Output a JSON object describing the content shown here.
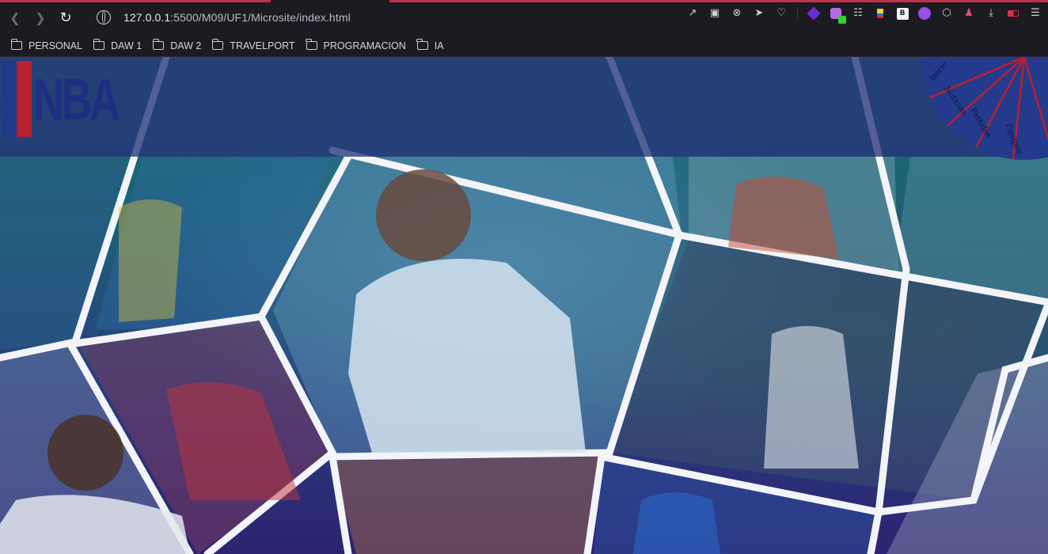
{
  "browser": {
    "url_host": "127.0.0.1",
    "url_path": ":5500/M09/UF1/Microsite/index.html",
    "bookmarks": [
      "PERSONAL",
      "DAW 1",
      "DAW 2",
      "TRAVELPORT",
      "PROGRAMACION",
      "IA"
    ],
    "extension_badge": "B"
  },
  "site": {
    "logo_text": "NBA",
    "menu": [
      "Inicio",
      "Noticias",
      "Partidos",
      "Equipos"
    ]
  },
  "colors": {
    "header_band": "#26347a",
    "accent_red": "#b8202e",
    "wheel": "#243a8c"
  }
}
